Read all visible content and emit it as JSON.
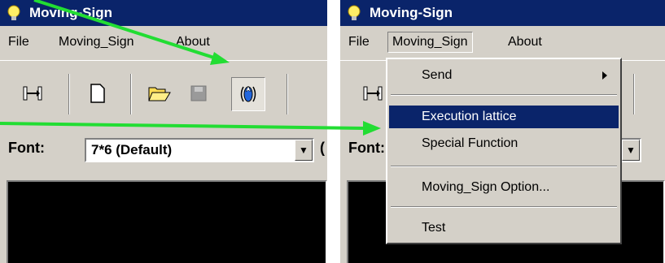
{
  "left": {
    "window_title": "Moving-Sign",
    "menu": [
      "File",
      "Moving_Sign",
      "About"
    ],
    "toolbar": [
      "connect-icon",
      "new-file-icon",
      "open-folder-icon",
      "save-disk-icon",
      "moving-sign-icon"
    ],
    "font_label": "Font:",
    "font_value": "7*6 (Default)",
    "cut_char": "("
  },
  "right": {
    "window_title": "Moving-Sign",
    "menu": [
      "File",
      "Moving_Sign",
      "About"
    ],
    "font_label": "Font:",
    "dropdown": {
      "items": [
        "Send",
        "Execution lattice",
        "Special Function",
        "Moving_Sign Option...",
        "Test"
      ],
      "highlighted": "Execution lattice"
    }
  },
  "colors": {
    "titlebar": "#0a246a",
    "face": "#d4d0c8",
    "highlight": "#0a246a",
    "arrow": "#22dd33"
  }
}
